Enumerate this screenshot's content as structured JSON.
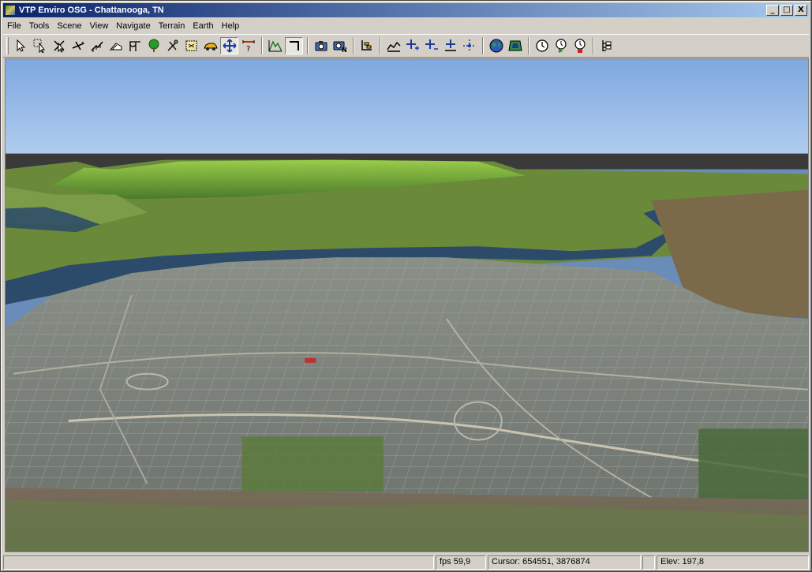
{
  "window": {
    "title": "VTP Enviro OSG - Chattanooga, TN"
  },
  "window_controls": {
    "minimize": "_",
    "maximize": "□",
    "close": "X"
  },
  "menu": [
    "File",
    "Tools",
    "Scene",
    "View",
    "Navigate",
    "Terrain",
    "Earth",
    "Help"
  ],
  "toolbar": {
    "groups": [
      [
        "select-tool",
        "select-box-tool",
        "select-move-tool",
        "move-tool",
        "draw-fence-tool",
        "add-structure-tool",
        "add-route-tool",
        "plant-tree-tool",
        "add-instance-tool",
        "select-area-tool",
        "vehicle-tool",
        "navigate-move-tool",
        "measure-tool"
      ],
      [
        "terrain-wireframe-tool",
        "corner-tool"
      ],
      [
        "snapshot-tool",
        "snapshot-numbered-tool"
      ],
      [
        "layers-tool"
      ],
      [
        "profile-tool",
        "nav-normal-tool",
        "nav-velocity-tool",
        "nav-grab-pivot-tool",
        "nav-pano-tool"
      ],
      [
        "globe-tool",
        "map-overview-tool"
      ],
      [
        "time-tool",
        "time-play-tool",
        "time-stop-tool"
      ],
      [
        "scene-graph-tool"
      ]
    ],
    "active": [
      "navigate-move-tool",
      "corner-tool"
    ]
  },
  "status": {
    "main": "",
    "fps": "fps 59,9",
    "cursor": "Cursor:  654551, 3876874",
    "blank": "",
    "elev": "Elev: 197,8"
  },
  "viewport": {
    "scene": "3d-terrain-view",
    "sky_color": "#86aee6",
    "horizon_color": "#a8c8ec"
  }
}
